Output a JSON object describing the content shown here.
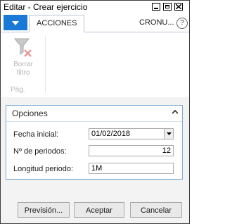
{
  "window": {
    "title": "Editar - Crear ejercicio"
  },
  "ribbon": {
    "tabs": [
      {
        "label": "ACCIONES",
        "active": true
      },
      {
        "label": "CRONU...",
        "active": false
      }
    ],
    "help_label": "?",
    "actions": [
      {
        "label": "Borrar filtro",
        "icon": "clear-filter-icon",
        "enabled": false
      }
    ],
    "group_label": "Pág."
  },
  "options": {
    "title": "Opciones",
    "fields": {
      "start_date": {
        "label": "Fecha inicial:",
        "value": "01/02/2018"
      },
      "num_periods": {
        "label": "Nº de periodos:",
        "value": "12"
      },
      "period_length": {
        "label": "Longitud periodo:",
        "value": "1M"
      }
    }
  },
  "buttons": {
    "preview": "Previsión...",
    "accept": "Aceptar",
    "cancel": "Cancelar"
  },
  "colors": {
    "accent": "#1a78d6",
    "panel_border": "#7aa9d8"
  }
}
